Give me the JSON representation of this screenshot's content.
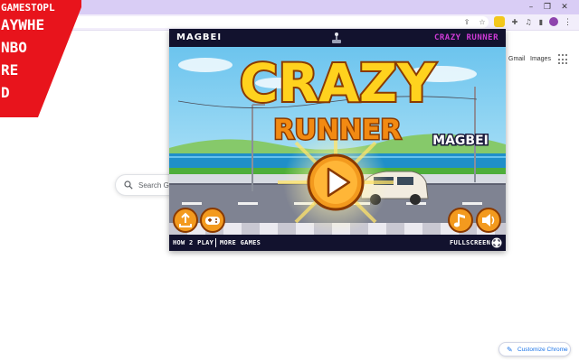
{
  "browser": {
    "omnibox_text": "",
    "window_controls": [
      "minimize-icon",
      "restore-icon",
      "close-icon"
    ],
    "toolbar_icons": [
      "share-icon",
      "bookmark-star-icon",
      "extension-icon",
      "puzzle-icon",
      "media-icon",
      "side-panel-icon",
      "profile-icon",
      "kebab-menu-icon"
    ]
  },
  "ntp": {
    "gmail_label": "Gmail",
    "images_label": "Images",
    "search_placeholder": "Search Go",
    "customize_label": "Customize Chrome"
  },
  "watermark": {
    "lines": [
      "GAMESTOPL",
      "AYWHE",
      "NBO",
      "RE",
      "D"
    ],
    "background": "#e8141c"
  },
  "game": {
    "header_logo": "MAGBEI",
    "header_title": "CRAZY RUNNER",
    "title_line1": "CRAZY",
    "title_line2": "RUNNER",
    "brand_badge": "MAGBEI",
    "footer_how": "HOW 2 PLAY",
    "footer_more": "MORE GAMES",
    "footer_fullscreen": "FULLSCREEN",
    "buttons": [
      "share-icon",
      "gamepad-icon",
      "play-icon",
      "music-icon",
      "sound-icon"
    ],
    "colors": {
      "title_fill": "#ffd21e",
      "title_orange": "#f28a12",
      "title_outline": "#8a3a00",
      "header_accent": "#cf3bd6",
      "button_orange": "#f39a1e",
      "sky": "#8fd0ef",
      "sea": "#1f8fc9",
      "road": "#7f8392"
    }
  }
}
